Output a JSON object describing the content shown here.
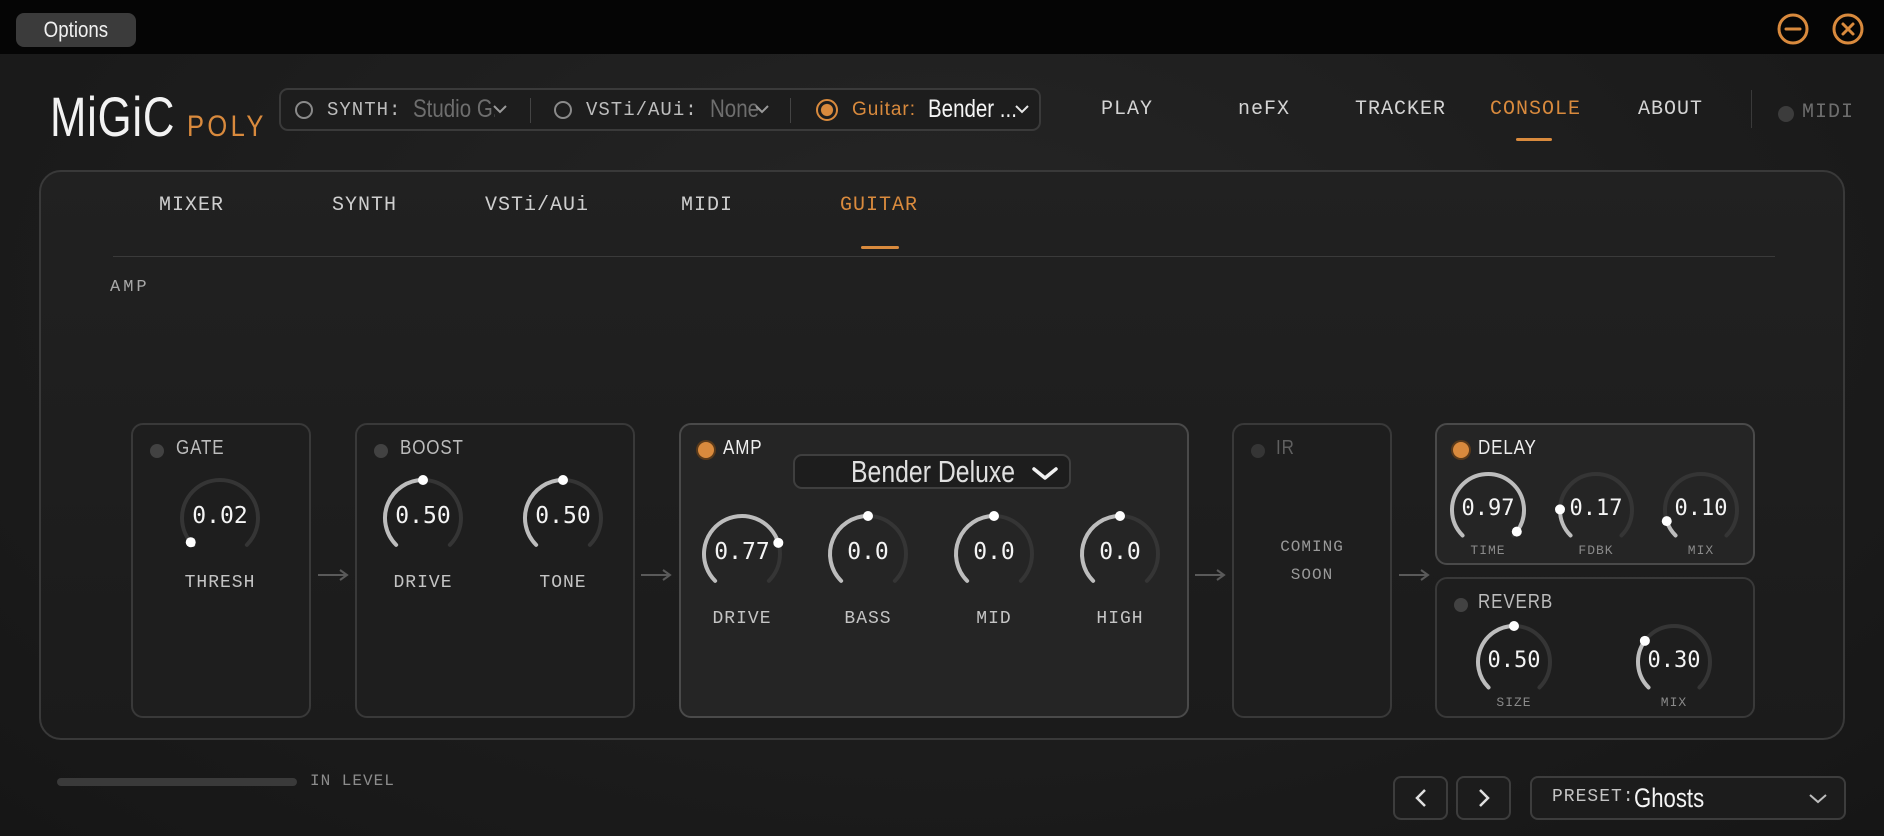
{
  "titlebar": {
    "options_label": "Options",
    "minimize_icon": "minus-circle-icon",
    "close_icon": "x-circle-icon"
  },
  "logo": {
    "main": "MiGiC",
    "sub": "POLY"
  },
  "sources": {
    "synth": {
      "label": "SYNTH:",
      "value": "Studio G...",
      "selected": false
    },
    "vst": {
      "label": "VSTi/AUi:",
      "value": "None",
      "selected": false
    },
    "guitar": {
      "label": "Guitar:",
      "value": "Bender ...",
      "selected": true
    }
  },
  "nav": {
    "play": "PLAY",
    "nefx": "neFX",
    "tracker": "TRACKER",
    "console": "CONSOLE",
    "about": "ABOUT",
    "active": "CONSOLE",
    "midi": "MIDI"
  },
  "console": {
    "tabs": {
      "mixer": "MIXER",
      "synth": "SYNTH",
      "vst": "VSTi/AUi",
      "midi": "MIDI",
      "guitar": "GUITAR",
      "active": "GUITAR"
    },
    "section": "AMP",
    "gate": {
      "title": "GATE",
      "enabled": false,
      "thresh": {
        "label": "THRESH",
        "value": "0.02",
        "level": 0.02
      }
    },
    "boost": {
      "title": "BOOST",
      "enabled": false,
      "drive": {
        "label": "DRIVE",
        "value": "0.50",
        "level": 0.5
      },
      "tone": {
        "label": "TONE",
        "value": "0.50",
        "level": 0.5
      }
    },
    "amp": {
      "title": "AMP",
      "enabled": true,
      "model": "Bender Deluxe",
      "drive": {
        "label": "DRIVE",
        "value": "0.77",
        "level": 0.77
      },
      "bass": {
        "label": "BASS",
        "value": "0.0",
        "level": 0.5
      },
      "mid": {
        "label": "MID",
        "value": "0.0",
        "level": 0.5
      },
      "high": {
        "label": "HIGH",
        "value": "0.0",
        "level": 0.5
      }
    },
    "ir": {
      "title": "IR",
      "enabled": false,
      "line1": "COMING",
      "line2": "SOON"
    },
    "delay": {
      "title": "DELAY",
      "enabled": true,
      "time": {
        "label": "TIME",
        "value": "0.97",
        "level": 0.97
      },
      "fdbk": {
        "label": "FDBK",
        "value": "0.17",
        "level": 0.17
      },
      "mix": {
        "label": "MIX",
        "value": "0.10",
        "level": 0.1
      }
    },
    "reverb": {
      "title": "REVERB",
      "enabled": false,
      "size": {
        "label": "SIZE",
        "value": "0.50",
        "level": 0.5
      },
      "mix": {
        "label": "MIX",
        "value": "0.30",
        "level": 0.3
      }
    }
  },
  "footer": {
    "in_level_label": "IN LEVEL",
    "in_level": 0.0,
    "prev_icon": "chevron-left-icon",
    "next_icon": "chevron-right-icon",
    "preset_label": "PRESET:",
    "preset_value": "Ghosts"
  },
  "colors": {
    "accent": "#d98a3d",
    "background": "#1c1c1c",
    "border": "#393939",
    "knob_track": "#353535",
    "knob_arc": "#bdbdbd"
  }
}
